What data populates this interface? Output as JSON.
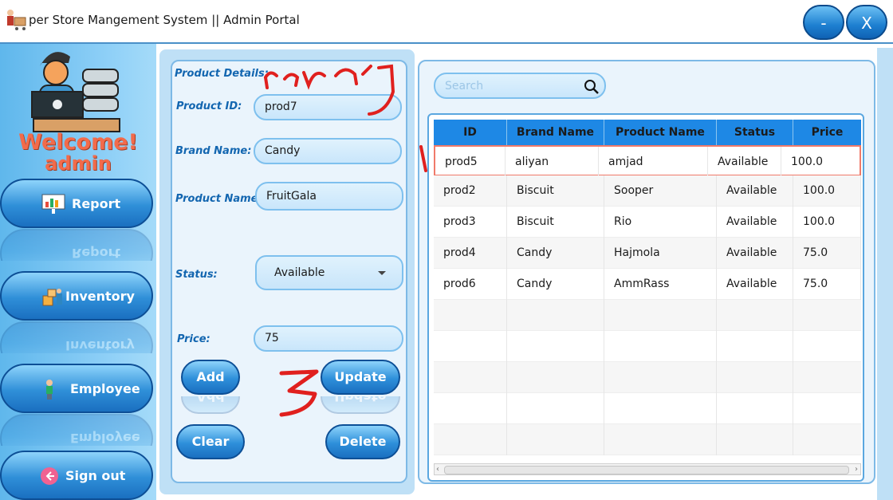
{
  "window": {
    "title": "per Store Mangement System || Admin Portal",
    "minimize_label": "-",
    "close_label": "X"
  },
  "sidebar": {
    "welcome_line1": "Welcome!",
    "welcome_line2": "admin",
    "items": [
      {
        "label": "Report",
        "icon": "report-icon"
      },
      {
        "label": "Inventory",
        "icon": "inventory-icon"
      },
      {
        "label": "Employee",
        "icon": "employee-icon"
      },
      {
        "label": "Sign out",
        "icon": "sign-out-icon"
      }
    ]
  },
  "form": {
    "product_details_label": "Product Details:",
    "product_id_label": "Product ID:",
    "product_id_value": "prod7",
    "brand_name_label": "Brand Name:",
    "brand_name_value": "Candy",
    "product_name_label": "Product Name:",
    "product_name_value": "FruitGala",
    "status_label": "Status:",
    "status_value": "Available",
    "price_label": "Price:",
    "price_value": "75",
    "add_label": "Add",
    "update_label": "Update",
    "clear_label": "Clear",
    "delete_label": "Delete"
  },
  "search": {
    "placeholder": "Search"
  },
  "table": {
    "columns": [
      "ID",
      "Brand Name",
      "Product Name",
      "Status",
      "Price"
    ],
    "rows": [
      [
        "prod5",
        "aliyan",
        "amjad",
        "Available",
        "100.0"
      ],
      [
        "prod2",
        "Biscuit",
        "Sooper",
        "Available",
        "100.0"
      ],
      [
        "prod3",
        "Biscuit",
        "Rio",
        "Available",
        "100.0"
      ],
      [
        "prod4",
        "Candy",
        "Hajmola",
        "Available",
        "75.0"
      ],
      [
        "prod6",
        "Candy",
        "AmmRass",
        "Available",
        "75.0"
      ]
    ],
    "selected_row": 0
  },
  "colors": {
    "accent": "#1e88e5",
    "welcome": "#f26b4b",
    "annotation": "#e0201e"
  }
}
